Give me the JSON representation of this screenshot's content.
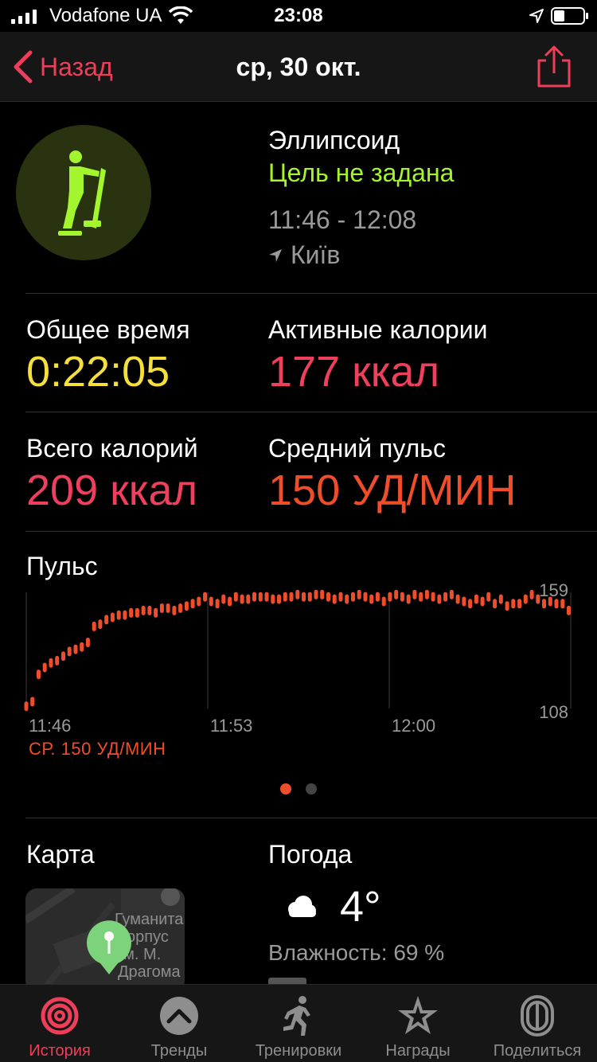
{
  "status_bar": {
    "carrier": "Vodafone UA",
    "time": "23:08"
  },
  "nav": {
    "back_label": "Назад",
    "title": "ср, 30 окт."
  },
  "workout": {
    "type": "Эллипсоид",
    "goal": "Цель не задана",
    "time_range": "11:46 - 12:08",
    "location": "Київ",
    "icon": "elliptical-icon"
  },
  "metrics": {
    "total_time_label": "Общее время",
    "total_time_value": "0:22:05",
    "active_cal_label": "Активные калории",
    "active_cal_value": "177 ккал",
    "total_cal_label": "Всего калорий",
    "total_cal_value": "209 ккал",
    "avg_hr_label": "Средний пульс",
    "avg_hr_value": "150 УД/МИН"
  },
  "heart_rate": {
    "title": "Пульс",
    "avg_label": "СР. 150 УД/МИН",
    "max_label": "159",
    "min_label": "108",
    "x_labels": [
      "11:46",
      "11:53",
      "12:00"
    ]
  },
  "chart_data": {
    "type": "scatter",
    "title": "Пульс",
    "ylim": [
      108,
      159
    ],
    "x_ticks": [
      "11:46",
      "11:53",
      "12:00"
    ],
    "x_unit": "minutes since 11:46",
    "xlim": [
      0,
      22.08
    ],
    "series": [
      {
        "x": [
          0,
          0.25,
          0.5,
          0.75,
          1,
          1.25,
          1.5,
          1.75,
          2,
          2.25,
          2.5,
          2.75,
          3,
          3.25,
          3.5,
          3.75,
          4,
          4.25,
          4.5,
          4.75,
          5,
          5.25,
          5.5,
          5.75,
          6,
          6.25,
          6.5,
          6.75,
          7,
          7.25,
          7.5,
          7.75,
          8,
          8.25,
          8.5,
          8.75,
          9,
          9.25,
          9.5,
          9.75,
          10,
          10.25,
          10.5,
          10.75,
          11,
          11.25,
          11.5,
          11.75,
          12,
          12.25,
          12.5,
          12.75,
          13,
          13.25,
          13.5,
          13.75,
          14,
          14.25,
          14.5,
          14.75,
          15,
          15.25,
          15.5,
          15.75,
          16,
          16.25,
          16.5,
          16.75,
          17,
          17.25,
          17.5,
          17.75,
          18,
          18.25,
          18.5,
          18.75,
          19,
          19.25,
          19.5,
          19.75,
          20,
          20.25,
          20.5,
          20.75,
          21,
          21.25,
          21.5,
          21.75,
          22
        ],
        "y": [
          109,
          111,
          123,
          126,
          128,
          129,
          131,
          133,
          134,
          135,
          137,
          144,
          145,
          147,
          148,
          149,
          149,
          150,
          150,
          151,
          151,
          150,
          152,
          152,
          151,
          152,
          153,
          154,
          155,
          157,
          155,
          154,
          156,
          155,
          157,
          156,
          156,
          157,
          157,
          157,
          156,
          156,
          157,
          157,
          158,
          157,
          157,
          158,
          158,
          157,
          156,
          157,
          156,
          157,
          158,
          157,
          156,
          157,
          155,
          157,
          158,
          157,
          156,
          158,
          157,
          158,
          157,
          156,
          157,
          158,
          156,
          155,
          154,
          156,
          155,
          157,
          154,
          156,
          153,
          154,
          154,
          156,
          158,
          156,
          154,
          155,
          154,
          154,
          151
        ]
      }
    ]
  },
  "map": {
    "title": "Карта",
    "label_line1": "Гуманита",
    "label_line2": "корпус",
    "label_line3": "им. М.",
    "label_line4": "Драгома"
  },
  "weather": {
    "title": "Погода",
    "temperature": "4°",
    "humidity": "Влажность: 69 %"
  },
  "tabs": [
    {
      "label": "История",
      "icon": "activity-rings-icon",
      "active": true
    },
    {
      "label": "Тренды",
      "icon": "trends-chevron-icon",
      "active": false
    },
    {
      "label": "Тренировки",
      "icon": "running-figure-icon",
      "active": false
    },
    {
      "label": "Награды",
      "icon": "award-star-icon",
      "active": false
    },
    {
      "label": "Поделиться",
      "icon": "sharing-icon",
      "active": false
    }
  ],
  "colors": {
    "accent_red": "#ef3e5a",
    "goal_green": "#a3f52d",
    "time_yellow": "#f5df3c",
    "calorie_red": "#f03f5c",
    "pulse_orange": "#f04d2a"
  }
}
